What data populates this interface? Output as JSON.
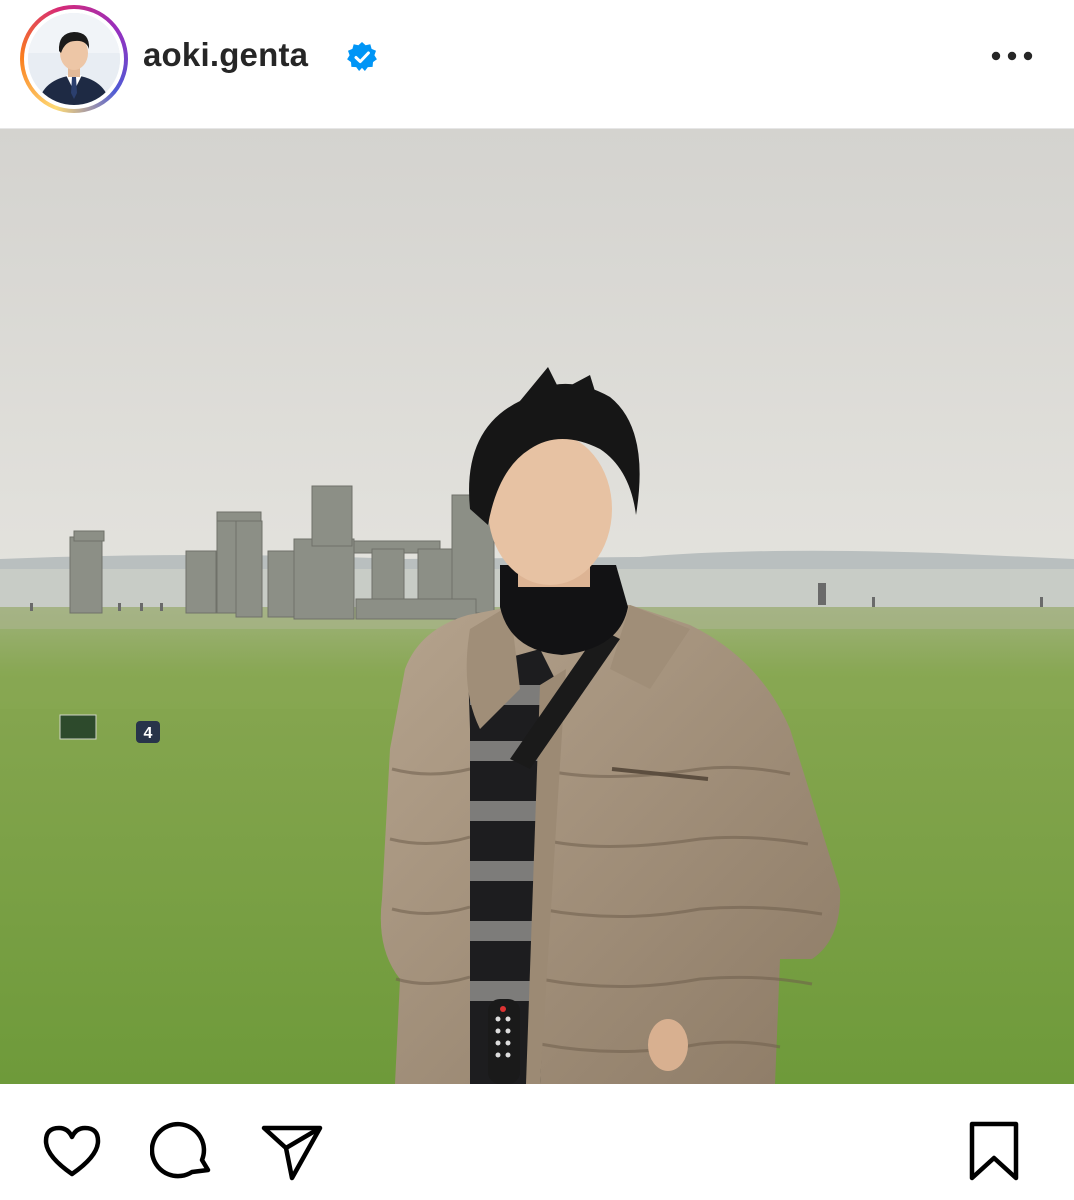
{
  "post": {
    "username": "aoki.genta",
    "verified": true
  },
  "photo": {
    "marker_number": "4"
  },
  "icons": {
    "avatar": "profile-avatar",
    "verified": "verified-badge-icon",
    "more": "more-options-icon",
    "like": "heart-icon",
    "comment": "comment-icon",
    "share": "paper-plane-icon",
    "save": "bookmark-icon"
  },
  "colors": {
    "verified": "#0095f6",
    "text": "#262626",
    "ring_start": "#feda75",
    "ring_end": "#d62976"
  }
}
